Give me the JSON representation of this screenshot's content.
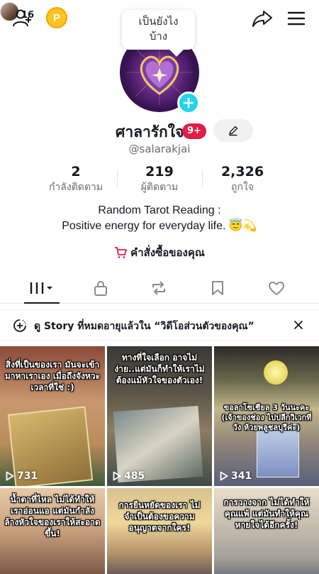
{
  "top_bar": {
    "icons": [
      "add-friend-icon",
      "coin-icon",
      "share-icon",
      "menu-icon"
    ],
    "coin_label": "P",
    "visitor_count": "16"
  },
  "tooltip": {
    "line1": "เป็นยังไง",
    "line2": "บ้าง"
  },
  "profile": {
    "username": "ศาลารักใจ",
    "notification_badge": "9+",
    "handle": "@salarakjai",
    "colors": {
      "badge": "#e11d48",
      "plus": "#20d5ec"
    }
  },
  "stats": [
    {
      "value": "2",
      "label": "กำลังติดตาม"
    },
    {
      "value": "219",
      "label": "ผู้ติดตาม"
    },
    {
      "value": "2,326",
      "label": "ถูกใจ"
    }
  ],
  "bio": {
    "line1": "Random Tarot Reading :",
    "line2": "Positive energy for everyday life. 😇💫"
  },
  "shop_label": "คำสั่งซื้อของคุณ",
  "tabs": [
    "videos-grid-icon",
    "lock-icon",
    "repost-icon",
    "bookmark-icon",
    "heart-icon"
  ],
  "story_banner": {
    "text": "ดู Story ที่หมดอายุแล้วใน “วิดีโอส่วนตัวของคุณ”"
  },
  "videos": [
    {
      "caption": "สิ่งที่เป็นของเรา มันจะเข้ามาหาเราเอง เมื่อถึงจังหวะเวลาที่ใช่ :)",
      "views": "731"
    },
    {
      "caption": "ทางที่ใจเลือก อาจไม่ง่าย..แต่มันก็ทำให้เราไม่ต้องแม้หัวใจของตัวเอง!",
      "views": "485"
    },
    {
      "caption": "ขอลาโซเชียล 3 วันนะคะ (เจ้าของช่อง ไปปลีกวิเวกที่ วัง ห้วยพลูชลบุรีค่ะ)",
      "views": "341"
    },
    {
      "caption": "น้ำตาที่ไหล ไม่ได้ทำให้เราอ่อนแอ แต่มันกำลังล้างหัวใจของเราให้สะอาดขึ้น!",
      "views": ""
    },
    {
      "caption": "การยืนหยัดของเรา ไม่จำเป็นต้องขอความอนุญาตจากใคร!",
      "views": ""
    },
    {
      "caption": "การวางจาก ไม่ได้ทำให้คุณแพ้ แต่มันทำให้คุณหายใจได้อีกครั้ง!",
      "views": ""
    }
  ]
}
